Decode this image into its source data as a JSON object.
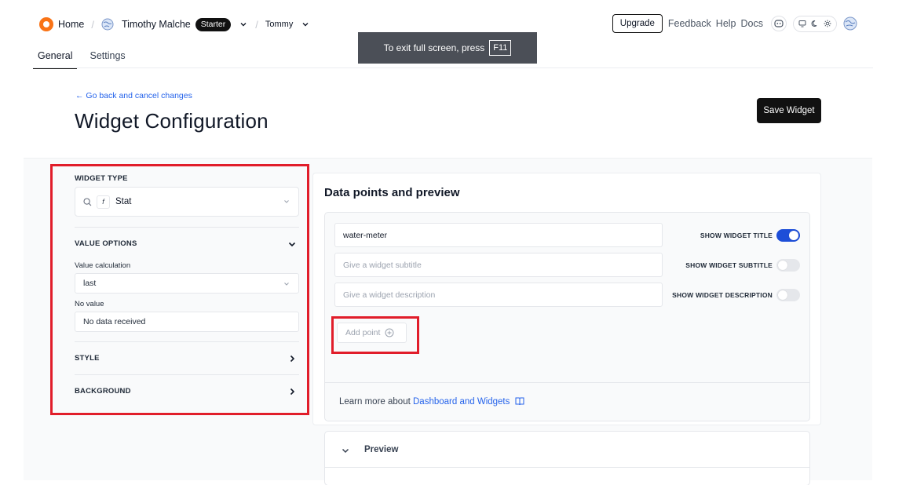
{
  "breadcrumb": {
    "home": "Home",
    "account": "Timothy Malche",
    "plan_badge": "Starter",
    "workspace": "Tommy"
  },
  "tabs": [
    {
      "label": "General",
      "active": true
    },
    {
      "label": "Settings",
      "active": false
    }
  ],
  "top_nav": {
    "upgrade": "Upgrade",
    "feedback": "Feedback",
    "help": "Help",
    "docs": "Docs"
  },
  "fullscreen_notice": {
    "text": "To exit full screen, press",
    "key": "F11"
  },
  "header": {
    "back_link": "← Go back and cancel changes",
    "title": "Widget Configuration",
    "save_button": "Save Widget"
  },
  "left_panel": {
    "widget_type_label": "WIDGET TYPE",
    "widget_type_value": "Stat",
    "value_options_label": "VALUE OPTIONS",
    "value_calc_label": "Value calculation",
    "value_calc_value": "last",
    "no_value_label": "No value",
    "no_value_value": "No data received",
    "style_label": "STYLE",
    "background_label": "BACKGROUND"
  },
  "right_panel": {
    "title": "Data points and preview",
    "widget_title_value": "water-meter",
    "subtitle_placeholder": "Give a widget subtitle",
    "description_placeholder": "Give a widget description",
    "show_title_label": "SHOW WIDGET TITLE",
    "show_subtitle_label": "SHOW WIDGET SUBTITLE",
    "show_description_label": "SHOW WIDGET DESCRIPTION",
    "show_title_on": true,
    "show_subtitle_on": false,
    "show_description_on": false,
    "add_point": "Add point",
    "learn_more_prefix": "Learn more about",
    "learn_more_link": "Dashboard and Widgets",
    "preview_label": "Preview"
  },
  "colors": {
    "accent": "#1d4ed8",
    "link": "#2563eb",
    "highlight": "#e11d2a",
    "brand": "#f97316"
  }
}
